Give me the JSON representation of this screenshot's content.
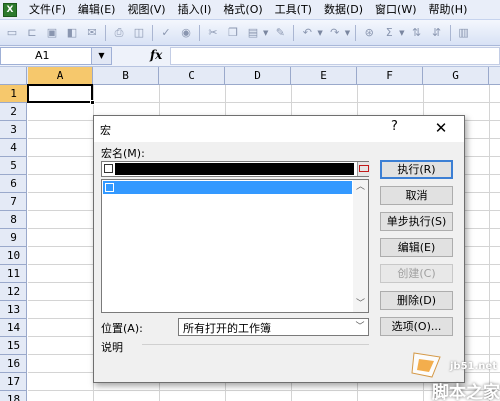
{
  "menubar": {
    "items": [
      "文件(F)",
      "编辑(E)",
      "视图(V)",
      "插入(I)",
      "格式(O)",
      "工具(T)",
      "数据(D)",
      "窗口(W)",
      "帮助(H)"
    ]
  },
  "toolbar": {
    "icons": [
      "new-icon",
      "open-icon",
      "save-icon",
      "permission-icon",
      "email-icon",
      "print-icon",
      "print-preview-icon",
      "spelling-icon",
      "research-icon",
      "cut-icon",
      "copy-icon",
      "paste-icon",
      "format-painter-icon",
      "undo-icon",
      "redo-icon",
      "hyperlink-icon",
      "autosum-icon",
      "sort-ascending-icon",
      "sort-descending-icon",
      "chart-icon"
    ]
  },
  "formula_bar": {
    "name_box": "A1",
    "fx_label": "fx",
    "formula": ""
  },
  "sheet": {
    "columns": [
      "A",
      "B",
      "C",
      "D",
      "E",
      "F",
      "G"
    ],
    "rows": [
      "1",
      "2",
      "3",
      "4",
      "5",
      "6",
      "7",
      "8",
      "9",
      "10",
      "11",
      "12",
      "13",
      "14",
      "15",
      "16",
      "17",
      "18"
    ],
    "active_cell": "A1"
  },
  "dialog": {
    "title": "宏",
    "help": "?",
    "close": "✕",
    "macro_name_label": "宏名(M):",
    "buttons": {
      "run": "执行(R)",
      "cancel": "取消",
      "step_into": "单步执行(S)",
      "edit": "编辑(E)",
      "create": "创建(C)",
      "delete": "删除(D)",
      "options": "选项(O)..."
    },
    "location_label": "位置(A):",
    "location_value": "所有打开的工作簿",
    "description_label": "说明"
  },
  "watermark": {
    "site": "jb51.net",
    "name": "脚本之家"
  },
  "colors": {
    "selection": "#3399ff",
    "dialog_bg": "#f0f0f0",
    "header_bg": "#e4eaf6",
    "active_header": "#f6c86c"
  }
}
